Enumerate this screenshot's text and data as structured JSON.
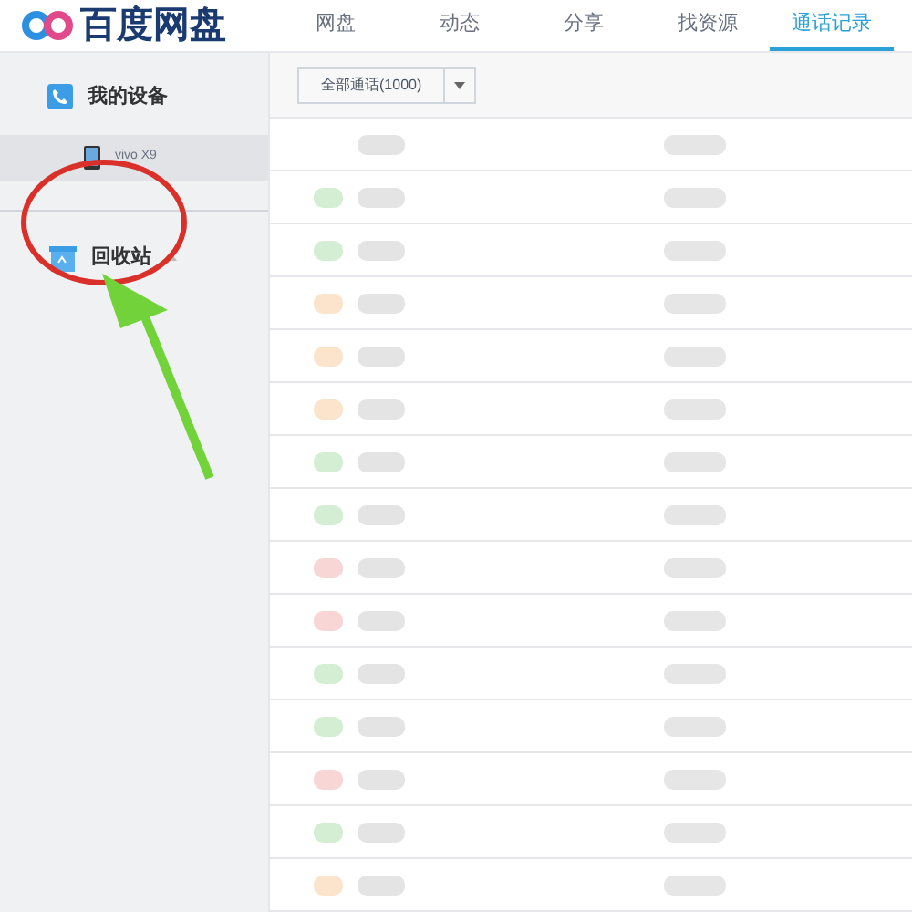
{
  "app": {
    "logo_text": "百度网盘"
  },
  "nav": [
    {
      "label": "网盘",
      "selected": false
    },
    {
      "label": "动态",
      "selected": false
    },
    {
      "label": "分享",
      "selected": false
    },
    {
      "label": "找资源",
      "selected": false
    },
    {
      "label": "通话记录",
      "selected": true
    }
  ],
  "sidebar": {
    "items": [
      {
        "kind": "section",
        "label": "我的设备",
        "selected": false
      },
      {
        "kind": "device",
        "label": "vivo X9",
        "selected": true
      },
      {
        "kind": "trash",
        "label": "回收站",
        "selected": false
      }
    ]
  },
  "filter": {
    "label": "全部通话(1000)"
  }
}
